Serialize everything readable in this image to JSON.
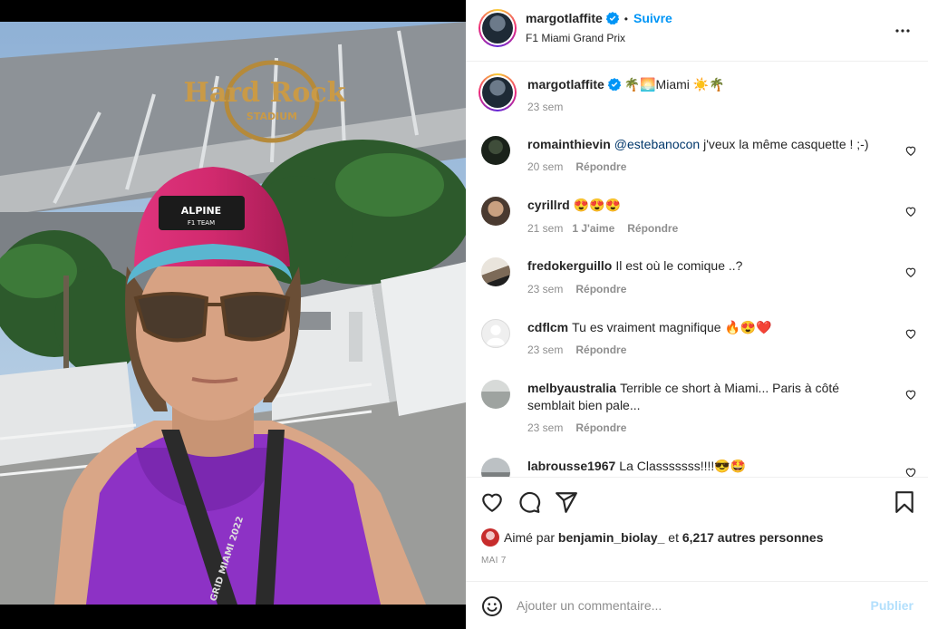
{
  "post": {
    "username": "margotlaffite",
    "follow_label": "Suivre",
    "separator": "•",
    "location": "F1 Miami Grand Prix",
    "more_icon": "more-horizontal-icon",
    "verified_icon": "verified-badge-icon"
  },
  "photo": {
    "stadium_sign_line1": "Hard Rock",
    "stadium_sign_line2": "STADIUM",
    "cap_logo_line1": "ALPINE",
    "cap_logo_line2": "F1 TEAM",
    "lanyard_text": "GRID MIAMI 2022"
  },
  "caption": {
    "username": "margotlaffite",
    "text": "🌴🌅Miami ☀️🌴",
    "time": "23 sem"
  },
  "comments": [
    {
      "username": "romainthievin",
      "mention": "@estebanocon",
      "text": " j'veux la même casquette ! ;-)",
      "time": "20 sem",
      "likes": "",
      "reply": "Répondre"
    },
    {
      "username": "cyrillrd",
      "mention": "",
      "text": "😍😍😍",
      "time": "21 sem",
      "likes": "1 J'aime",
      "reply": "Répondre"
    },
    {
      "username": "fredokerguillo",
      "mention": "",
      "text": "Il est où le comique ..?",
      "time": "23 sem",
      "likes": "",
      "reply": "Répondre"
    },
    {
      "username": "cdflcm",
      "mention": "",
      "text": "Tu es vraiment magnifique 🔥😍❤️",
      "time": "23 sem",
      "likes": "",
      "reply": "Répondre"
    },
    {
      "username": "melbyaustralia",
      "mention": "",
      "text": "Terrible ce short à Miami... Paris à côté semblait bien pale...",
      "time": "23 sem",
      "likes": "",
      "reply": "Répondre"
    },
    {
      "username": "labrousse1967",
      "mention": "",
      "text": "La Classsssss!!!!😎🤩",
      "time": "",
      "likes": "",
      "reply": ""
    }
  ],
  "actions": {
    "like_icon": "heart-icon",
    "comment_icon": "comment-bubble-icon",
    "share_icon": "paper-plane-icon",
    "save_icon": "bookmark-icon",
    "liked_by_prefix": "Aimé par",
    "liked_by_user": "benjamin_biolay_",
    "liked_by_and": "et",
    "liked_by_others": "6,217 autres personnes",
    "date": "MAI 7"
  },
  "add_comment": {
    "placeholder": "Ajouter un commentaire...",
    "publish_label": "Publier",
    "emoji_icon": "smiley-icon"
  },
  "colors": {
    "accent": "#0095f6",
    "publish_disabled": "#b2dffc",
    "muted": "#8e8e8e",
    "text": "#262626",
    "border": "#efefef"
  }
}
